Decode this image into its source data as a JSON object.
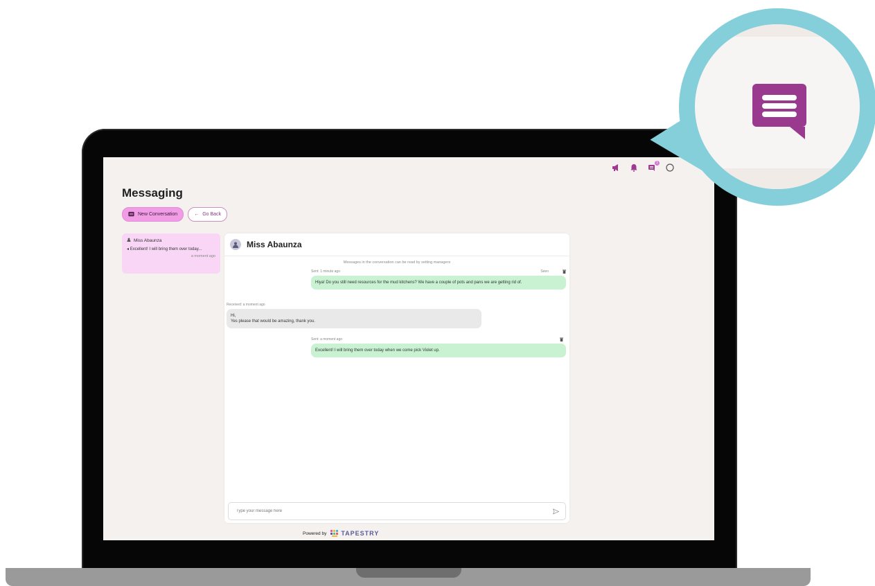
{
  "app": {
    "page_title": "Messaging",
    "new_conversation_label": "New Conversation",
    "go_back_label": "Go Back",
    "powered_by": "Powered by",
    "brand": "TAPESTRY"
  },
  "topbar": {
    "messages_badge": "1"
  },
  "conversations": [
    {
      "name": "Miss Abaunza",
      "preview": "Excellent! I will bring them over today...",
      "time": "a moment ago"
    }
  ],
  "chat": {
    "contact_name": "Miss Abaunza",
    "notice": "Messages in the conversation can be read by setting managers",
    "messages": [
      {
        "direction": "sent",
        "meta": "Sent: 1 minute ago",
        "status": "Seen",
        "text": "Hiya! Do you still need resources for the mud kitchens? We have a couple of pots and pans we are getting rid of."
      },
      {
        "direction": "received",
        "meta": "Received: a moment ago",
        "line1": "Hi,",
        "line2": "Yes please that would be amazing, thank you."
      },
      {
        "direction": "sent",
        "meta": "Sent: a moment ago",
        "text": "Excellent! I will bring them over today when we come pick Violet up."
      }
    ],
    "composer_placeholder": "Type your message here"
  },
  "colors": {
    "accent_pink": "#f19de6",
    "conversation_bg": "#f9d6f6",
    "sent_bubble": "#c8f2d2",
    "received_bubble": "#e9e9e9",
    "callout_ring": "#85cfdb",
    "message_icon": "#9a3a8e"
  },
  "icons": {
    "topbar": [
      "megaphone-icon",
      "bell-icon",
      "messages-icon",
      "user-icon"
    ],
    "callout": "messages-icon"
  }
}
